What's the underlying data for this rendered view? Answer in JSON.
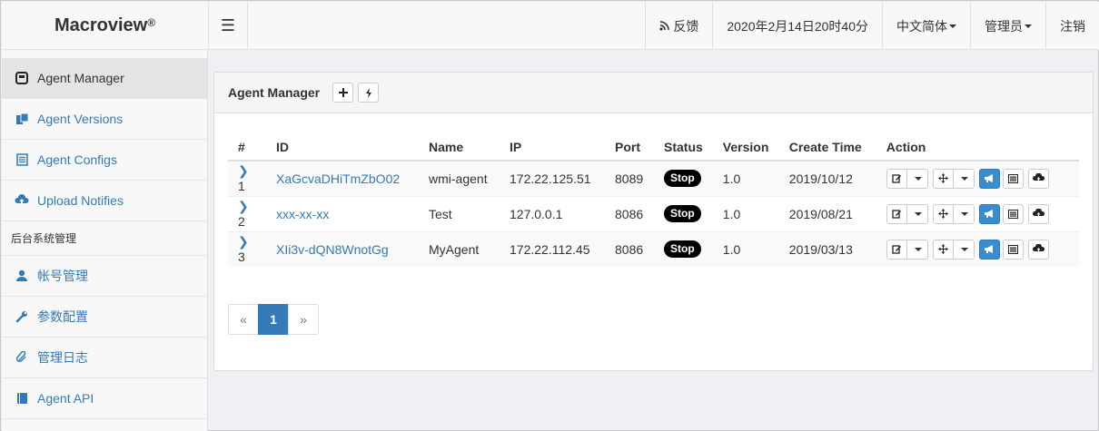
{
  "brand": {
    "name": "Macroview",
    "mark": "®"
  },
  "topnav": {
    "feedback": "反馈",
    "datetime": "2020年2月14日20时40分",
    "language": "中文简体",
    "user": "管理员",
    "logout": "注销"
  },
  "sidebar": {
    "items": [
      {
        "label": "Agent Manager",
        "icon": "agent-manager-icon"
      },
      {
        "label": "Agent Versions",
        "icon": "versions-icon"
      },
      {
        "label": "Agent Configs",
        "icon": "configs-icon"
      },
      {
        "label": "Upload Notifies",
        "icon": "upload-icon"
      }
    ],
    "section_header": "后台系统管理",
    "admin_items": [
      {
        "label": "帐号管理",
        "icon": "user-icon"
      },
      {
        "label": "参数配置",
        "icon": "wrench-icon"
      },
      {
        "label": "管理日志",
        "icon": "paperclip-icon"
      },
      {
        "label": "Agent API",
        "icon": "book-icon"
      }
    ]
  },
  "panel": {
    "title": "Agent Manager",
    "columns": [
      "#",
      "ID",
      "Name",
      "IP",
      "Port",
      "Status",
      "Version",
      "Create Time",
      "Action"
    ],
    "rows": [
      {
        "num": "1",
        "id": "XaGcvaDHiTmZbO02",
        "name": "wmi-agent",
        "ip": "172.22.125.51",
        "port": "8089",
        "status": "Stop",
        "version": "1.0",
        "created": "2019/10/12"
      },
      {
        "num": "2",
        "id": "xxx-xx-xx",
        "name": "Test",
        "ip": "127.0.0.1",
        "port": "8086",
        "status": "Stop",
        "version": "1.0",
        "created": "2019/08/21"
      },
      {
        "num": "3",
        "id": "XIi3v-dQN8WnotGg",
        "name": "MyAgent",
        "ip": "172.22.112.45",
        "port": "8086",
        "status": "Stop",
        "version": "1.0",
        "created": "2019/03/13"
      }
    ]
  },
  "pagination": {
    "prev": "«",
    "current": "1",
    "next": "»"
  },
  "colors": {
    "accent": "#337ab7",
    "badge": "#000000",
    "action_blue": "#3b8ccd"
  }
}
